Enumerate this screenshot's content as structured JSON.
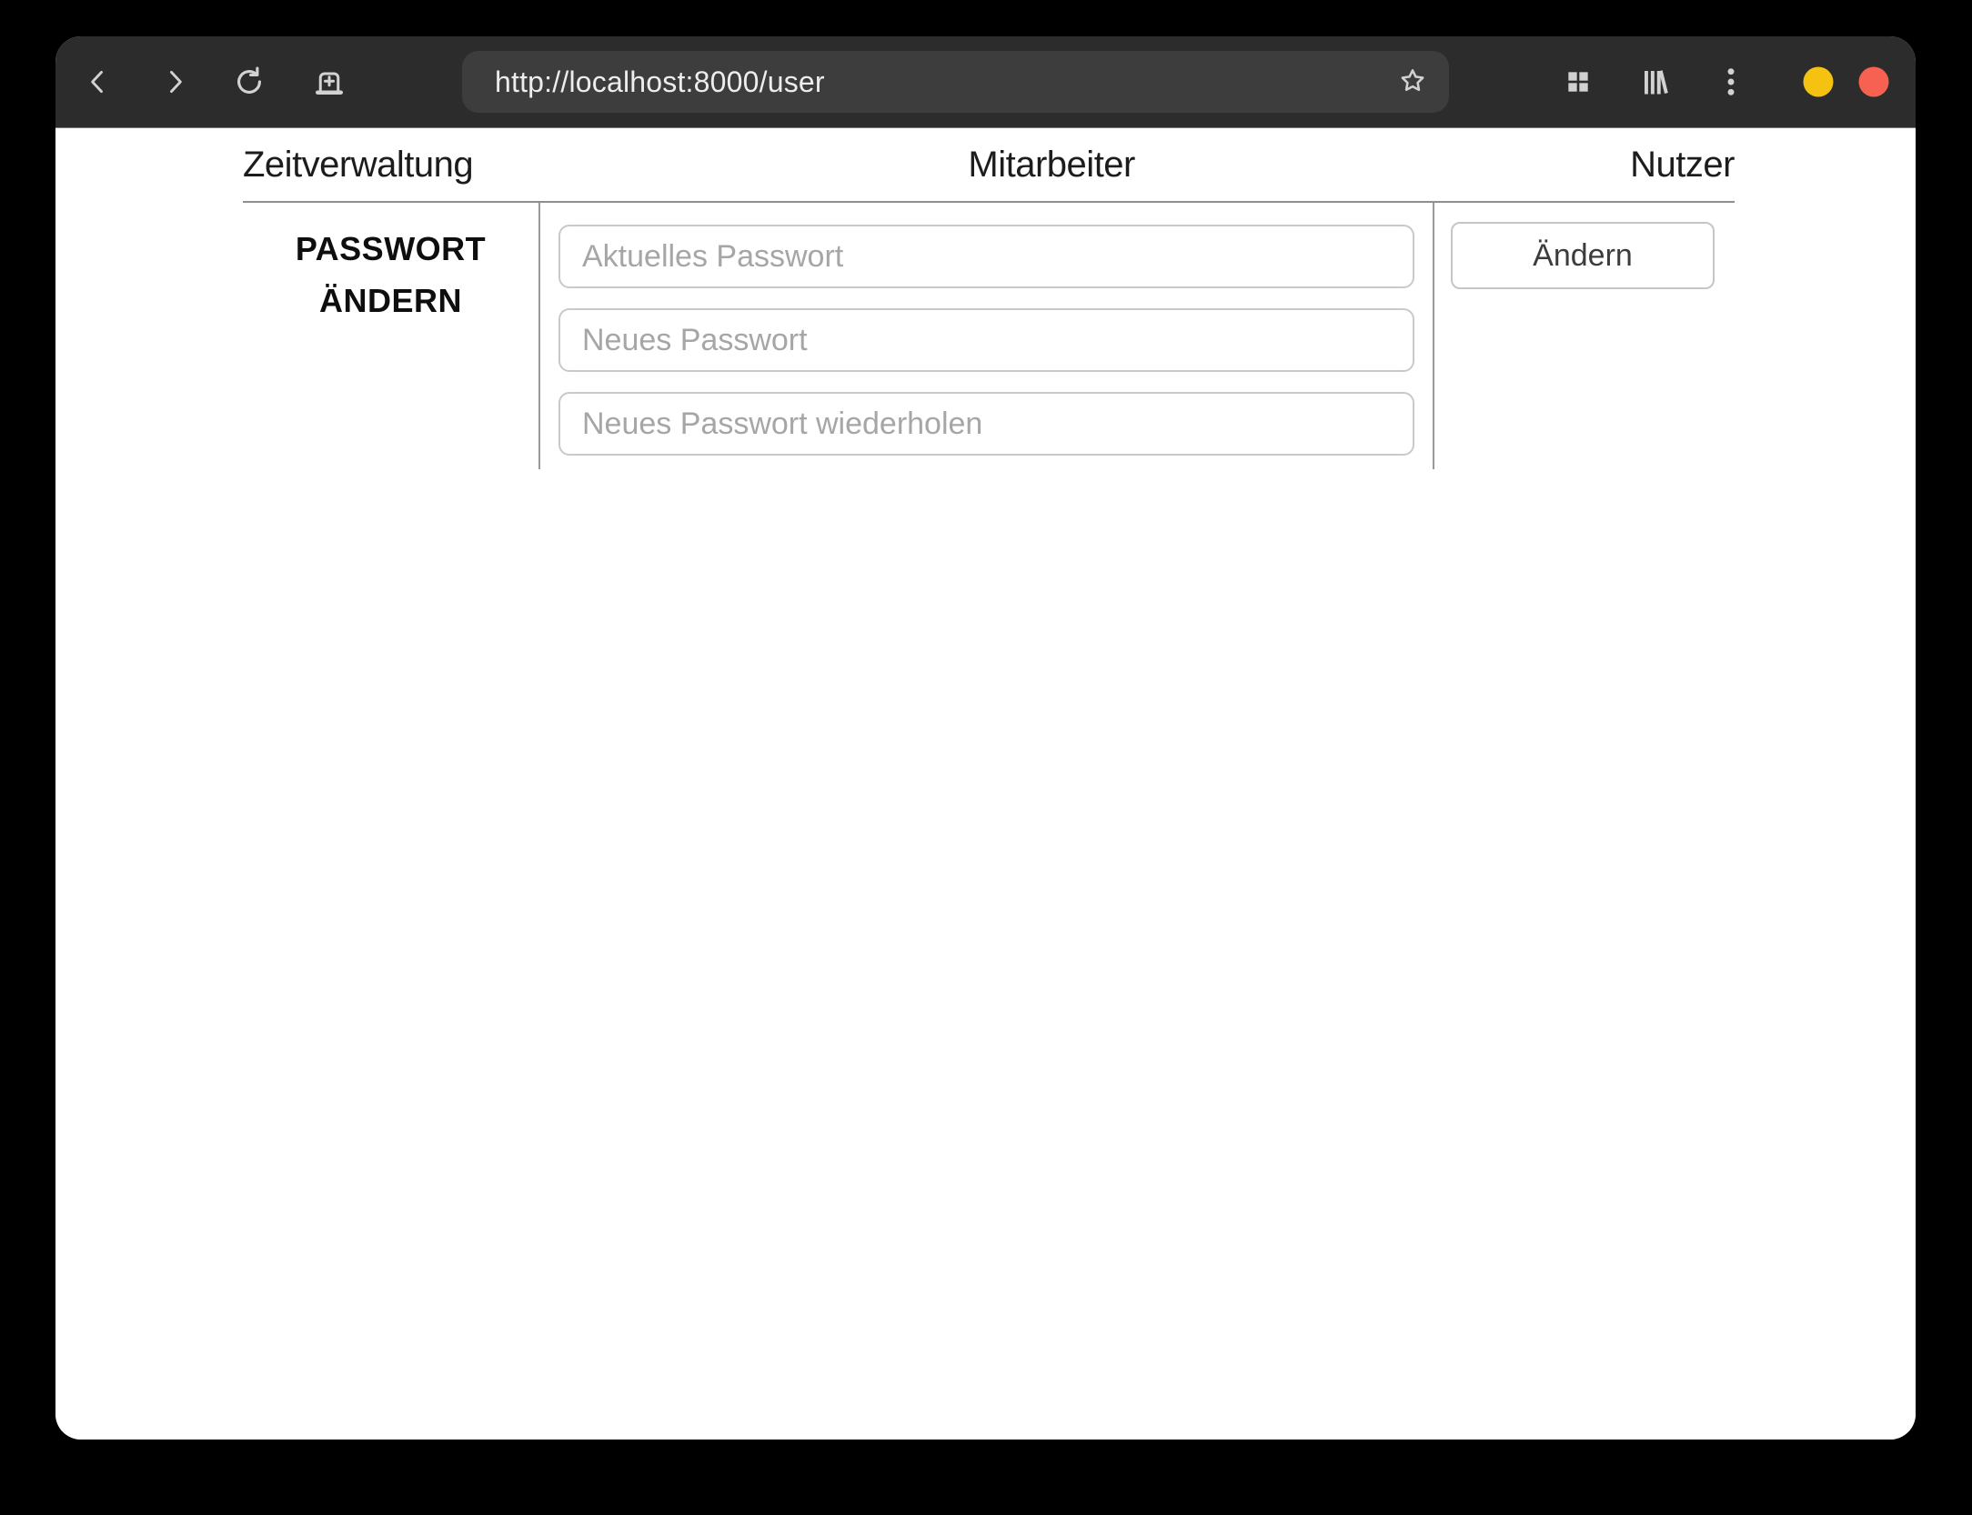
{
  "toolbar": {
    "url": "http://localhost:8000/user",
    "icons": {
      "back": "chevron-left",
      "forward": "chevron-right",
      "reload": "circular-arrow",
      "new_tab": "tab-with-plus",
      "bookmark": "star-outline",
      "tab_overview": "grid-2x2",
      "library": "books-on-shelf",
      "menu": "kebab-vertical"
    },
    "window_controls": {
      "minimize_color": "#f5c211",
      "close_color": "#f66151"
    }
  },
  "nav": {
    "items": [
      {
        "id": "zeitverwaltung",
        "label": "Zeitverwaltung"
      },
      {
        "id": "mitarbeiter",
        "label": "Mitarbeiter"
      },
      {
        "id": "nutzer",
        "label": "Nutzer"
      }
    ]
  },
  "password_form": {
    "title_line1": "PASSWORT",
    "title_line2": "ÄNDERN",
    "fields": [
      {
        "name": "current_password",
        "placeholder": "Aktuelles Passwort",
        "value": ""
      },
      {
        "name": "new_password",
        "placeholder": "Neues Passwort",
        "value": ""
      },
      {
        "name": "new_password_repeat",
        "placeholder": "Neues Passwort wiederholen",
        "value": ""
      }
    ],
    "submit_label": "Ändern"
  },
  "colors": {
    "toolbar_bg": "#2c2c2c",
    "urlbar_bg": "#3d3d3d",
    "page_bg": "#ffffff",
    "divider": "#999999",
    "nav_rule": "#8f8f8f",
    "input_border": "#c9c9c9",
    "placeholder_text": "#a6a6a6",
    "nav_text": "#1c1c1c"
  }
}
